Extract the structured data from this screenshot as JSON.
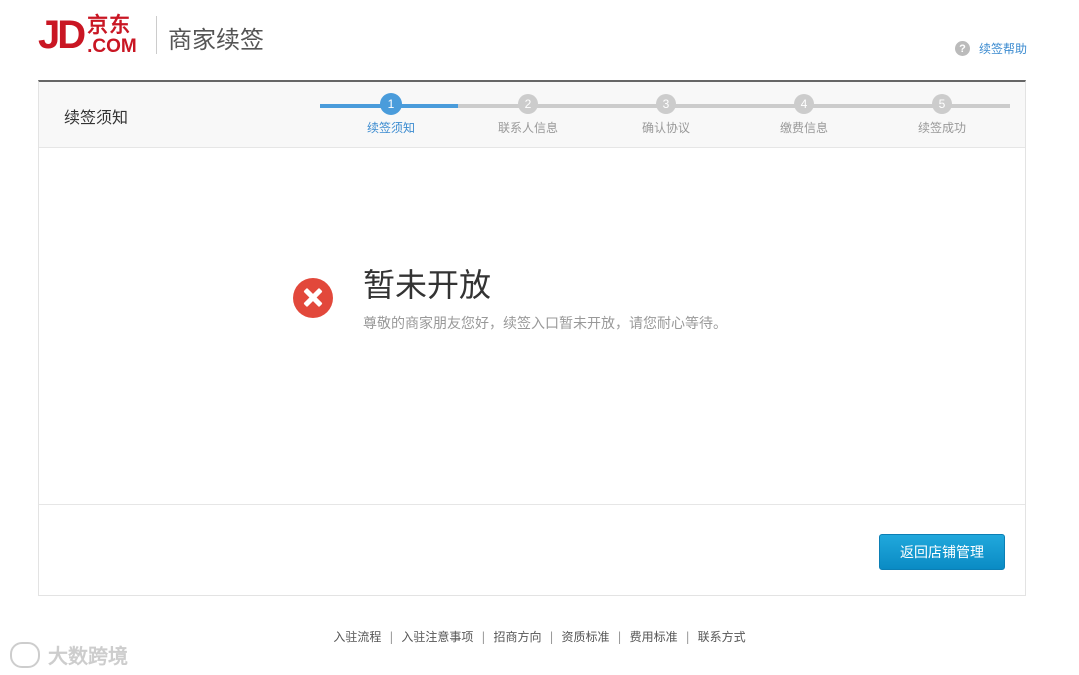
{
  "header": {
    "logo_jd": "JD",
    "logo_cn": "京东",
    "logo_com": ".COM",
    "title": "商家续签",
    "help_label": "续签帮助",
    "help_icon": "question-circle-icon"
  },
  "steps": {
    "title": "续签须知",
    "progress_fraction": 0.2,
    "items": [
      {
        "num": "1",
        "label": "续签须知",
        "active": true
      },
      {
        "num": "2",
        "label": "联系人信息",
        "active": false
      },
      {
        "num": "3",
        "label": "确认协议",
        "active": false
      },
      {
        "num": "4",
        "label": "缴费信息",
        "active": false
      },
      {
        "num": "5",
        "label": "续签成功",
        "active": false
      }
    ]
  },
  "message": {
    "icon": "error-x-icon",
    "title": "暂未开放",
    "description": "尊敬的商家朋友您好，续签入口暂未开放，请您耐心等待。"
  },
  "actions": {
    "back_button": "返回店铺管理"
  },
  "footer": {
    "links": [
      "入驻流程",
      "入驻注意事项",
      "招商方向",
      "资质标准",
      "费用标准",
      "联系方式"
    ],
    "separator": "|"
  },
  "watermark": {
    "text": "大数跨境"
  },
  "colors": {
    "brand_red": "#c91623",
    "accent_blue": "#4a9cdb",
    "error_red": "#e2483b",
    "button_blue": "#0a8bc4"
  }
}
